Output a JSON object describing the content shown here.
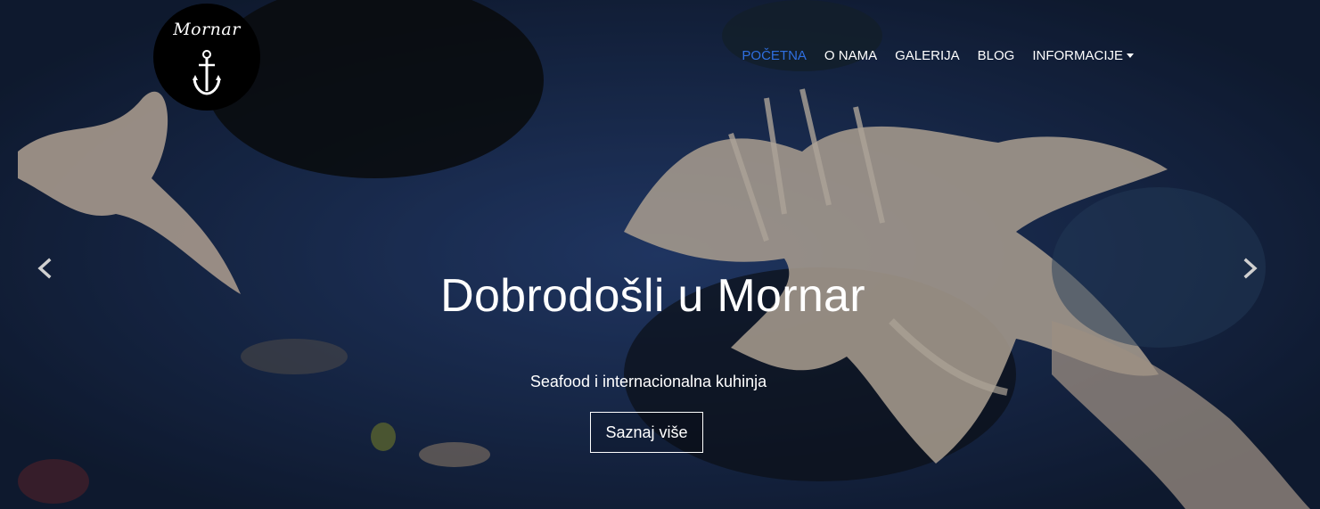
{
  "brand": {
    "logo_text": "Mornar",
    "logo_icon": "anchor-icon"
  },
  "nav": {
    "items": [
      {
        "label": "POČETNA",
        "active": true
      },
      {
        "label": "O NAMA",
        "active": false
      },
      {
        "label": "GALERIJA",
        "active": false
      },
      {
        "label": "BLOG",
        "active": false
      },
      {
        "label": "INFORMACIJE",
        "active": false,
        "dropdown": true
      }
    ]
  },
  "hero": {
    "title": "Dobrodošli u Mornar",
    "subtitle": "Seafood i internacionalna kuhinja",
    "cta_label": "Saznaj više"
  },
  "carousel": {
    "prev_icon": "chevron-left-icon",
    "next_icon": "chevron-right-icon"
  },
  "colors": {
    "active_nav": "#2f6fe0",
    "text": "#ffffff",
    "background": "#1c2d4f"
  }
}
